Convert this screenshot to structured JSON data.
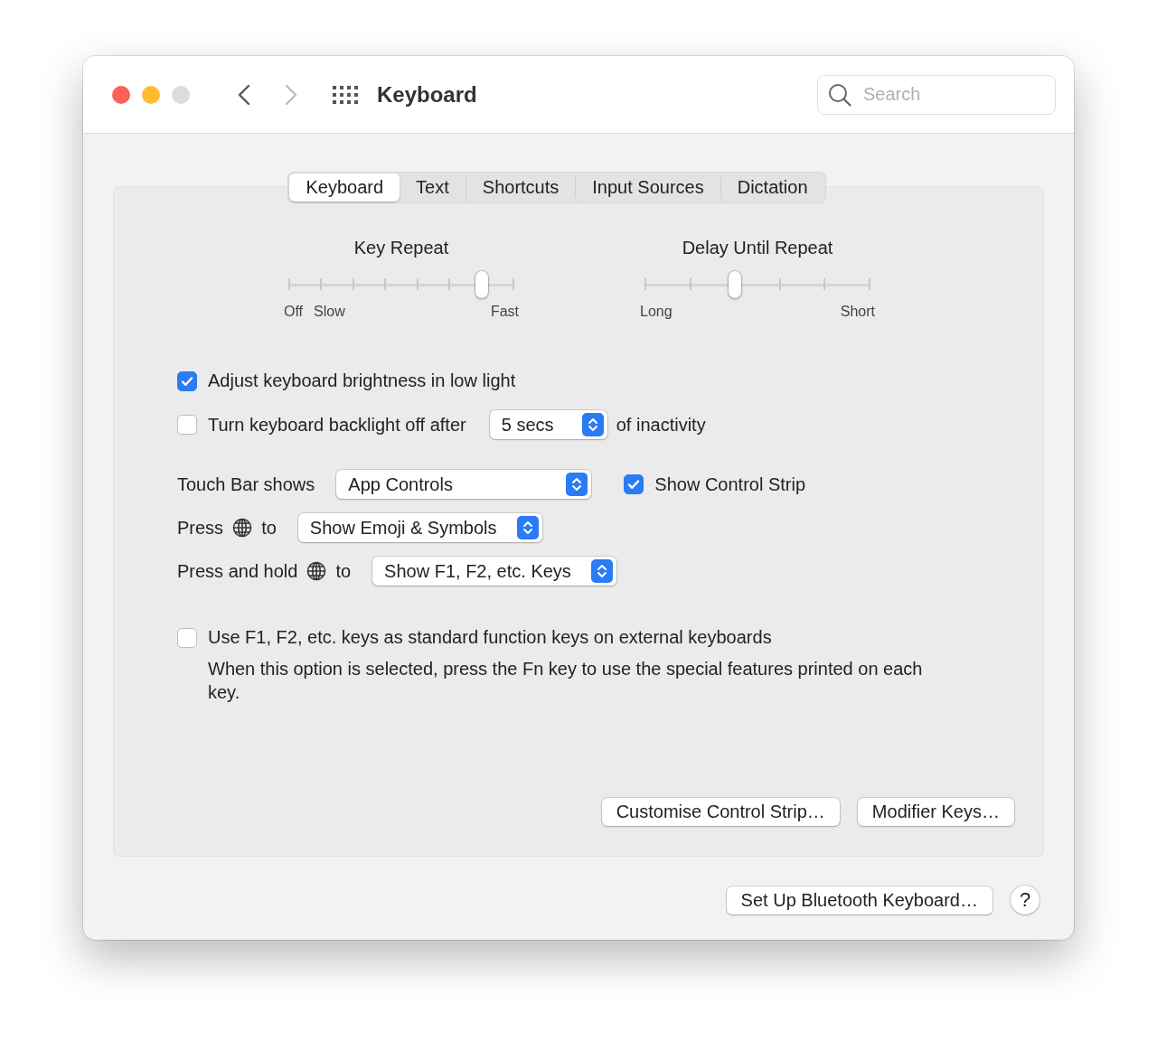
{
  "window": {
    "title": "Keyboard",
    "search": {
      "placeholder": "Search"
    }
  },
  "tabs": [
    {
      "label": "Keyboard",
      "selected": true
    },
    {
      "label": "Text",
      "selected": false
    },
    {
      "label": "Shortcuts",
      "selected": false
    },
    {
      "label": "Input Sources",
      "selected": false
    },
    {
      "label": "Dictation",
      "selected": false
    }
  ],
  "sliders": [
    {
      "title": "Key Repeat",
      "level": 0.857,
      "labels": [
        "Off",
        "Slow",
        "Fast"
      ]
    },
    {
      "title": "Delay Until Repeat",
      "level": 0.4,
      "labels": [
        "Long",
        "Short"
      ]
    }
  ],
  "options": [
    {
      "kind": "checkbox",
      "label": "Adjust keyboard brightness in low light",
      "checked": true
    },
    {
      "kind": "checkbox-popup",
      "label": "Turn keyboard backlight off after",
      "checked": false,
      "popup": "5 secs",
      "suffix": "of inactivity"
    },
    {
      "kind": "popup-checkbox",
      "label": "Touch Bar shows",
      "popup": "App Controls",
      "check_label": "Show Control Strip",
      "checked": true
    },
    {
      "kind": "globe-popup",
      "label": "Press",
      "after": "to",
      "popup": "Show Emoji & Symbols"
    },
    {
      "kind": "globe-popup",
      "label": "Press and hold",
      "after": "to",
      "popup": "Show F1, F2, etc. Keys"
    },
    {
      "kind": "checkbox-note",
      "label": "Use F1, F2, etc. keys as standard function keys on external keyboards",
      "checked": false,
      "note": "When this option is selected, press the Fn key to use the special features printed on each key."
    }
  ],
  "panel_buttons": [
    "Customise Control Strip…",
    "Modifier Keys…"
  ],
  "footer": {
    "button": "Set Up Bluetooth Keyboard…",
    "help": "?"
  }
}
